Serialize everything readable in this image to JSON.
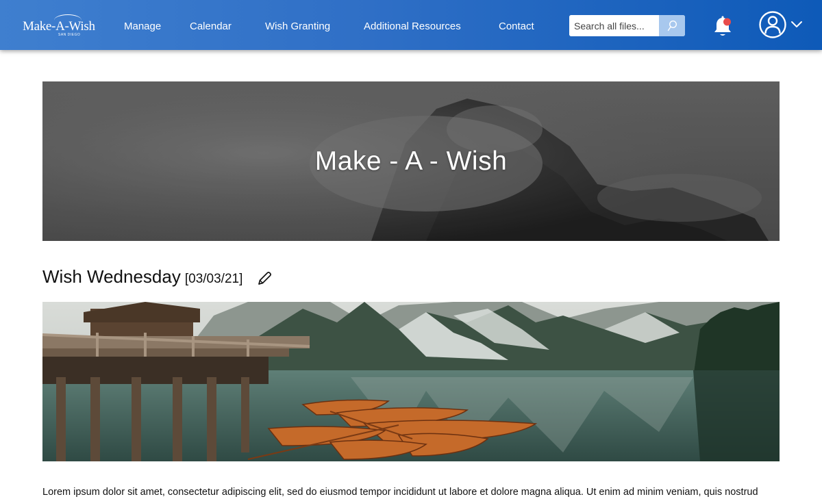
{
  "brand": {
    "logo_text": "Make-A-Wish",
    "logo_sub": "SAN DIEGO"
  },
  "nav": {
    "items": [
      {
        "label": "Manage"
      },
      {
        "label": "Calendar"
      },
      {
        "label": "Wish Granting"
      },
      {
        "label": "Additional Resources"
      },
      {
        "label": "Contact"
      }
    ]
  },
  "search": {
    "placeholder": "Search all files..."
  },
  "icons": {
    "search": "search-icon",
    "notifications": "bell-icon",
    "account": "user-circle-icon",
    "account_menu": "chevron-down-icon",
    "edit": "pencil-icon"
  },
  "colors": {
    "header_start": "#3f7fcf",
    "header_end": "#0e5ab8",
    "notification_dot": "#e84c4c"
  },
  "hero": {
    "title": "Make - A - Wish"
  },
  "post": {
    "title": "Wish Wednesday",
    "date": "[03/03/21]",
    "body": "Lorem ipsum dolor sit amet, consectetur adipiscing elit, sed do eiusmod tempor incididunt ut labore et dolore magna aliqua. Ut enim ad minim veniam, quis nostrud"
  }
}
